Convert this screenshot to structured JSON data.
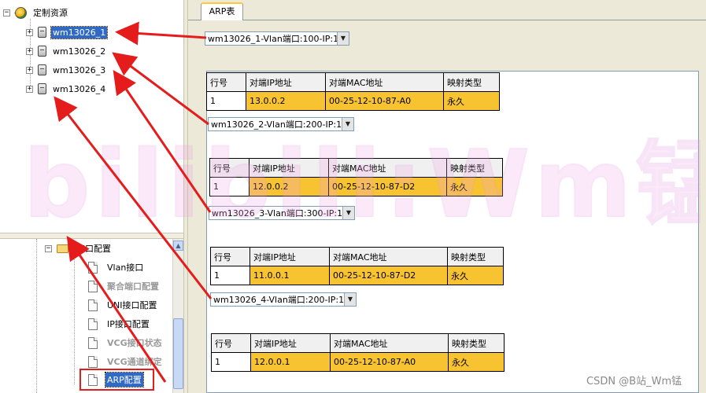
{
  "tree": {
    "root_label": "定制资源",
    "devices": [
      {
        "label": "wm13026_1",
        "selected": true
      },
      {
        "label": "wm13026_2",
        "selected": false
      },
      {
        "label": "wm13026_3",
        "selected": false
      },
      {
        "label": "wm13026_4",
        "selected": false
      }
    ]
  },
  "config_tree": {
    "folder_label": "接口配置",
    "items": [
      {
        "label": "Vlan接口",
        "disabled": false
      },
      {
        "label": "聚合端口配置",
        "disabled": true
      },
      {
        "label": "UNI接口配置",
        "disabled": false
      },
      {
        "label": "IP接口配置",
        "disabled": false
      },
      {
        "label": "VCG接口状态",
        "disabled": true
      },
      {
        "label": "VCG通道绑定",
        "disabled": true
      },
      {
        "label": "ARP配置",
        "disabled": false,
        "selected": true
      }
    ]
  },
  "tab": {
    "label": "ARP表"
  },
  "arp_blocks": [
    {
      "selector": "wm13026_1-Vlan端口:100-IP:1",
      "row": {
        "no": "1",
        "ip": "13.0.0.2",
        "mac": "00-25-12-10-87-A0",
        "type": "永久"
      }
    },
    {
      "selector": "wm13026_2-Vlan端口:200-IP:1",
      "row": {
        "no": "1",
        "ip": "12.0.0.2",
        "mac": "00-25-12-10-87-D2",
        "type": "永久"
      }
    },
    {
      "selector": "wm13026_3-Vlan端口:300-IP:1",
      "row": {
        "no": "1",
        "ip": "11.0.0.1",
        "mac": "00-25-12-10-87-D2",
        "type": "永久"
      }
    },
    {
      "selector": "wm13026_4-Vlan端口:200-IP:1",
      "row": {
        "no": "1",
        "ip": "12.0.0.1",
        "mac": "00-25-12-10-87-A0",
        "type": "永久"
      }
    }
  ],
  "table_headers": {
    "no": "行号",
    "ip": "对端IP地址",
    "mac": "对端MAC地址",
    "type": "映射类型"
  },
  "icons": {
    "expand": "plus-icon",
    "collapse": "minus-icon",
    "dropdown": "chevron-down-icon"
  },
  "colors": {
    "highlight": "#f7c331",
    "annotation": "#e51c1c",
    "selection": "#316ac5"
  },
  "watermark": {
    "text": "bilibili:Wm锰"
  },
  "credit": "CSDN @B站_Wm锰"
}
